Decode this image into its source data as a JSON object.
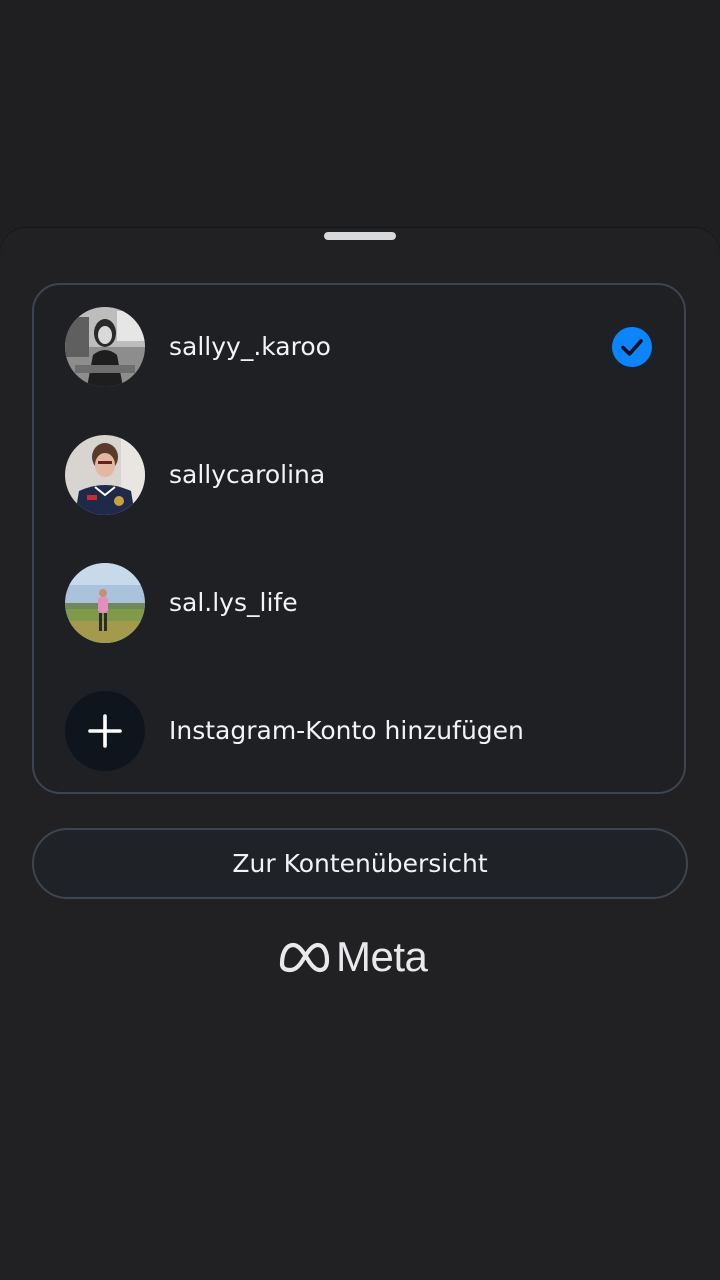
{
  "accounts": [
    {
      "username": "sallyy_.karoo",
      "selected": true,
      "avatar_icon": "profile-photo-bw"
    },
    {
      "username": "sallycarolina",
      "selected": false,
      "avatar_icon": "profile-photo-jersey"
    },
    {
      "username": "sal.lys_life",
      "selected": false,
      "avatar_icon": "profile-photo-field"
    }
  ],
  "add_account": {
    "label": "Instagram-Konto hinzufügen",
    "icon": "plus-icon"
  },
  "overview_button": {
    "label": "Zur Kontenübersicht"
  },
  "brand": {
    "name": "Meta",
    "icon": "meta-infinity-icon"
  },
  "colors": {
    "background": "#1f1f21",
    "card_border": "#3d4550",
    "accent": "#0a84ff",
    "text": "#f1f3f5"
  }
}
